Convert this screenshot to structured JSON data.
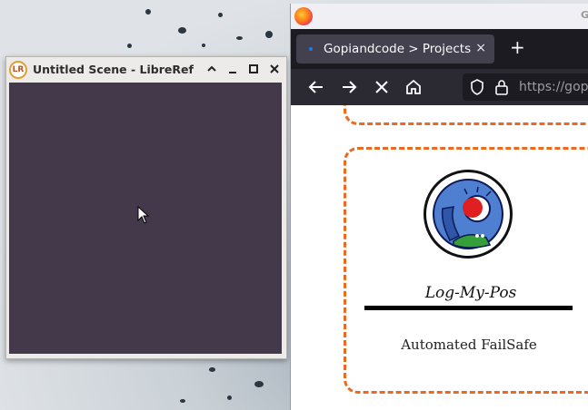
{
  "librerref_window": {
    "title": "Untitled Scene - LibreRef (",
    "app_icon_text": "LR",
    "buttons": [
      "chevron-up",
      "minimize",
      "maximize",
      "close"
    ],
    "canvas_color": "#44394a"
  },
  "browser": {
    "top_text": "G",
    "tab": {
      "title": "Gopiandcode > Projects",
      "close": "×"
    },
    "new_tab_label": "+",
    "url": "https://gop",
    "project_card": {
      "name": "Log-My-Pos",
      "description": "Automated FailSafe"
    },
    "accent_color": "#ec6a1d"
  }
}
